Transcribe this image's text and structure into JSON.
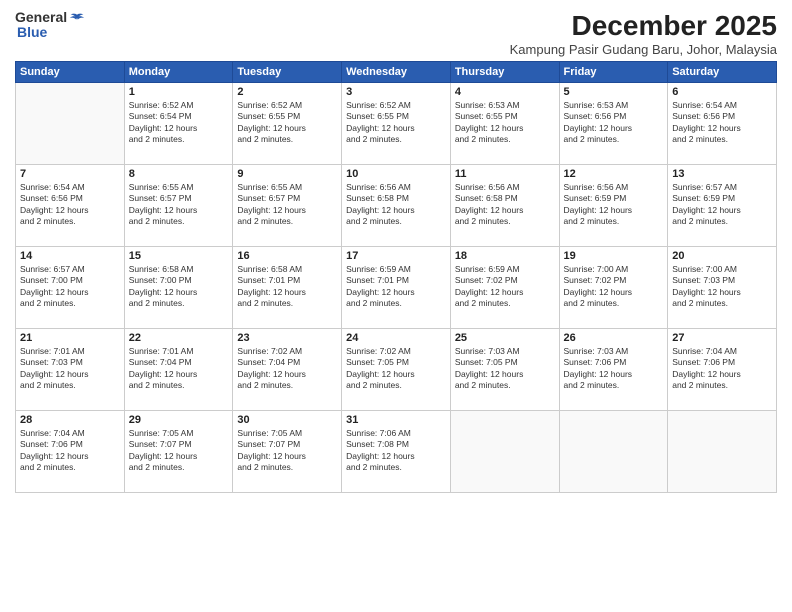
{
  "logo": {
    "general": "General",
    "blue": "Blue"
  },
  "header": {
    "month_year": "December 2025",
    "location": "Kampung Pasir Gudang Baru, Johor, Malaysia"
  },
  "days_of_week": [
    "Sunday",
    "Monday",
    "Tuesday",
    "Wednesday",
    "Thursday",
    "Friday",
    "Saturday"
  ],
  "weeks": [
    [
      {
        "day": "",
        "info": ""
      },
      {
        "day": "1",
        "info": "Sunrise: 6:52 AM\nSunset: 6:54 PM\nDaylight: 12 hours\nand 2 minutes."
      },
      {
        "day": "2",
        "info": "Sunrise: 6:52 AM\nSunset: 6:55 PM\nDaylight: 12 hours\nand 2 minutes."
      },
      {
        "day": "3",
        "info": "Sunrise: 6:52 AM\nSunset: 6:55 PM\nDaylight: 12 hours\nand 2 minutes."
      },
      {
        "day": "4",
        "info": "Sunrise: 6:53 AM\nSunset: 6:55 PM\nDaylight: 12 hours\nand 2 minutes."
      },
      {
        "day": "5",
        "info": "Sunrise: 6:53 AM\nSunset: 6:56 PM\nDaylight: 12 hours\nand 2 minutes."
      },
      {
        "day": "6",
        "info": "Sunrise: 6:54 AM\nSunset: 6:56 PM\nDaylight: 12 hours\nand 2 minutes."
      }
    ],
    [
      {
        "day": "7",
        "info": "Sunrise: 6:54 AM\nSunset: 6:56 PM\nDaylight: 12 hours\nand 2 minutes."
      },
      {
        "day": "8",
        "info": "Sunrise: 6:55 AM\nSunset: 6:57 PM\nDaylight: 12 hours\nand 2 minutes."
      },
      {
        "day": "9",
        "info": "Sunrise: 6:55 AM\nSunset: 6:57 PM\nDaylight: 12 hours\nand 2 minutes."
      },
      {
        "day": "10",
        "info": "Sunrise: 6:56 AM\nSunset: 6:58 PM\nDaylight: 12 hours\nand 2 minutes."
      },
      {
        "day": "11",
        "info": "Sunrise: 6:56 AM\nSunset: 6:58 PM\nDaylight: 12 hours\nand 2 minutes."
      },
      {
        "day": "12",
        "info": "Sunrise: 6:56 AM\nSunset: 6:59 PM\nDaylight: 12 hours\nand 2 minutes."
      },
      {
        "day": "13",
        "info": "Sunrise: 6:57 AM\nSunset: 6:59 PM\nDaylight: 12 hours\nand 2 minutes."
      }
    ],
    [
      {
        "day": "14",
        "info": "Sunrise: 6:57 AM\nSunset: 7:00 PM\nDaylight: 12 hours\nand 2 minutes."
      },
      {
        "day": "15",
        "info": "Sunrise: 6:58 AM\nSunset: 7:00 PM\nDaylight: 12 hours\nand 2 minutes."
      },
      {
        "day": "16",
        "info": "Sunrise: 6:58 AM\nSunset: 7:01 PM\nDaylight: 12 hours\nand 2 minutes."
      },
      {
        "day": "17",
        "info": "Sunrise: 6:59 AM\nSunset: 7:01 PM\nDaylight: 12 hours\nand 2 minutes."
      },
      {
        "day": "18",
        "info": "Sunrise: 6:59 AM\nSunset: 7:02 PM\nDaylight: 12 hours\nand 2 minutes."
      },
      {
        "day": "19",
        "info": "Sunrise: 7:00 AM\nSunset: 7:02 PM\nDaylight: 12 hours\nand 2 minutes."
      },
      {
        "day": "20",
        "info": "Sunrise: 7:00 AM\nSunset: 7:03 PM\nDaylight: 12 hours\nand 2 minutes."
      }
    ],
    [
      {
        "day": "21",
        "info": "Sunrise: 7:01 AM\nSunset: 7:03 PM\nDaylight: 12 hours\nand 2 minutes."
      },
      {
        "day": "22",
        "info": "Sunrise: 7:01 AM\nSunset: 7:04 PM\nDaylight: 12 hours\nand 2 minutes."
      },
      {
        "day": "23",
        "info": "Sunrise: 7:02 AM\nSunset: 7:04 PM\nDaylight: 12 hours\nand 2 minutes."
      },
      {
        "day": "24",
        "info": "Sunrise: 7:02 AM\nSunset: 7:05 PM\nDaylight: 12 hours\nand 2 minutes."
      },
      {
        "day": "25",
        "info": "Sunrise: 7:03 AM\nSunset: 7:05 PM\nDaylight: 12 hours\nand 2 minutes."
      },
      {
        "day": "26",
        "info": "Sunrise: 7:03 AM\nSunset: 7:06 PM\nDaylight: 12 hours\nand 2 minutes."
      },
      {
        "day": "27",
        "info": "Sunrise: 7:04 AM\nSunset: 7:06 PM\nDaylight: 12 hours\nand 2 minutes."
      }
    ],
    [
      {
        "day": "28",
        "info": "Sunrise: 7:04 AM\nSunset: 7:06 PM\nDaylight: 12 hours\nand 2 minutes."
      },
      {
        "day": "29",
        "info": "Sunrise: 7:05 AM\nSunset: 7:07 PM\nDaylight: 12 hours\nand 2 minutes."
      },
      {
        "day": "30",
        "info": "Sunrise: 7:05 AM\nSunset: 7:07 PM\nDaylight: 12 hours\nand 2 minutes."
      },
      {
        "day": "31",
        "info": "Sunrise: 7:06 AM\nSunset: 7:08 PM\nDaylight: 12 hours\nand 2 minutes."
      },
      {
        "day": "",
        "info": ""
      },
      {
        "day": "",
        "info": ""
      },
      {
        "day": "",
        "info": ""
      }
    ]
  ]
}
